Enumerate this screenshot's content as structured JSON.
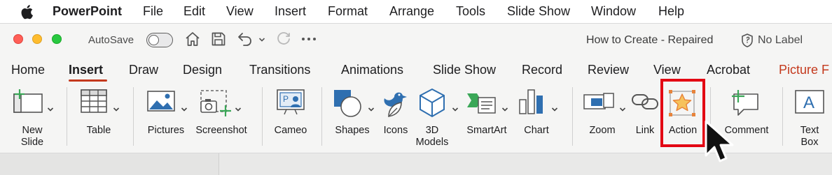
{
  "menubar": {
    "app_name": "PowerPoint",
    "items": [
      "File",
      "Edit",
      "View",
      "Insert",
      "Format",
      "Arrange",
      "Tools",
      "Slide Show",
      "Window",
      "Help"
    ]
  },
  "titlebar": {
    "autosave_label": "AutoSave",
    "autosave_on": false,
    "document_title": "How to Create  -  Repaired",
    "sensitivity_label": "No Label"
  },
  "ribbon": {
    "tabs": [
      "Home",
      "Insert",
      "Draw",
      "Design",
      "Transitions",
      "Animations",
      "Slide Show",
      "Record",
      "Review",
      "View",
      "Acrobat",
      "Picture F"
    ],
    "active_tab": "Insert",
    "buttons": {
      "new_slide": [
        "New",
        "Slide"
      ],
      "table": "Table",
      "pictures": "Pictures",
      "screenshot": "Screenshot",
      "cameo": "Cameo",
      "shapes": "Shapes",
      "icons": "Icons",
      "models_3d": [
        "3D",
        "Models"
      ],
      "smartart": "SmartArt",
      "chart": "Chart",
      "zoom": "Zoom",
      "link": "Link",
      "action": "Action",
      "comment": "Comment",
      "text_box": [
        "Text",
        "Box"
      ]
    }
  },
  "colors": {
    "accent": "#c4391d",
    "highlight": "#e30613",
    "icon_blue": "#2f6fb0",
    "icon_green": "#3aa757"
  }
}
